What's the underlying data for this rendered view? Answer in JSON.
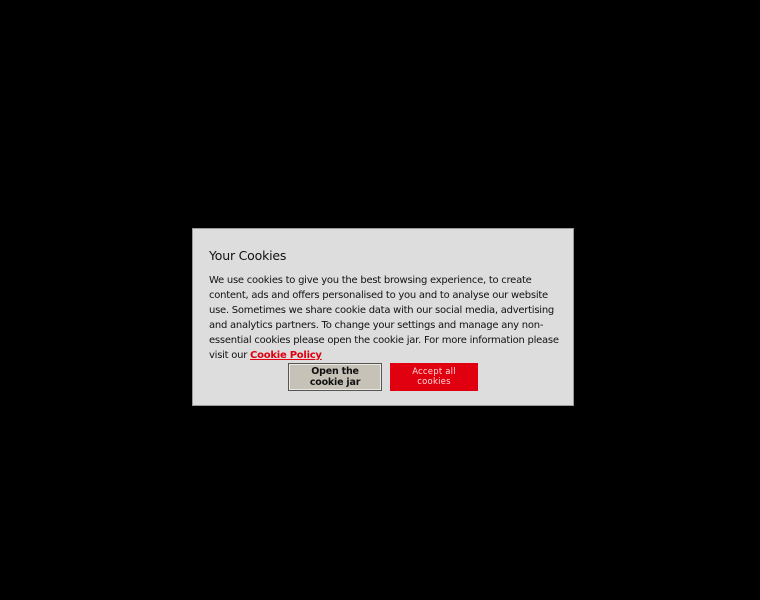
{
  "cookie_dialog": {
    "title": "Your Cookies",
    "body_text": "We use cookies to give you the best browsing experience, to create content, ads and offers personalised to you and to analyse our website use. Sometimes we share cookie data with our social media, advertising and analytics partners. To change your settings and manage any non-essential cookies please open the cookie jar. For more information please visit our ",
    "policy_link_label": "Cookie Policy",
    "open_jar_label": "Open the cookie jar",
    "accept_all_label": "Accept all cookies"
  },
  "colors": {
    "backdrop": "#000000",
    "dialog_background": "#dddddd",
    "accent_red": "#e0000f",
    "secondary_button": "#c7c2b8"
  }
}
